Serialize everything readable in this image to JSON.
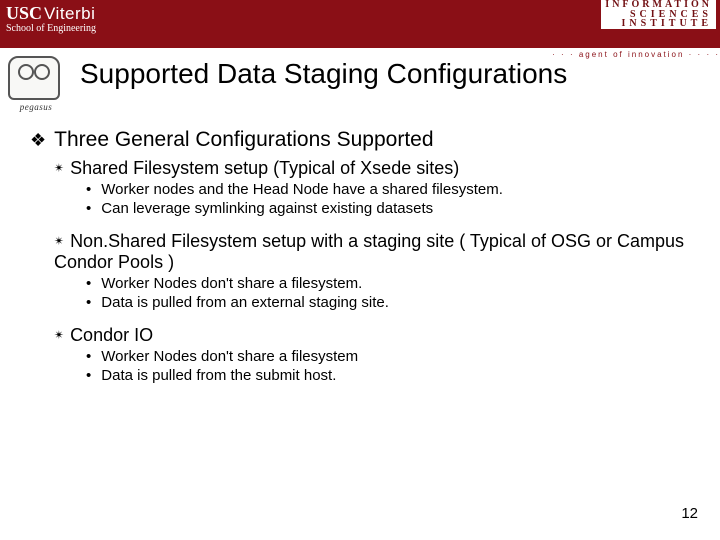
{
  "header": {
    "usc_line1_a": "USC",
    "usc_line1_b": "Viterbi",
    "usc_line2": "School of Engineering",
    "isi_l1": "INFORMATION",
    "isi_l2": "SCIENCES",
    "isi_l3": "INSTITUTE",
    "dots": "· · ·  agent of innovation  · · · ·"
  },
  "logo_label": "pegasus",
  "title": "Supported Data Staging Configurations",
  "main_heading": "Three General Configurations Supported",
  "sections": [
    {
      "heading": "Shared Filesystem setup (Typical of Xsede sites)",
      "bullets": [
        "Worker nodes and the Head Node have a shared filesystem.",
        "Can leverage symlinking against existing datasets"
      ]
    },
    {
      "heading": "Non.Shared Filesystem setup with a staging site ( Typical of OSG or Campus Condor Pools )",
      "bullets": [
        "Worker Nodes don't share a filesystem.",
        "Data is pulled from an external staging site."
      ]
    },
    {
      "heading": "Condor IO",
      "bullets": [
        "Worker Nodes don't share a filesystem",
        "Data is pulled from the submit host."
      ]
    }
  ],
  "page_number": "12"
}
